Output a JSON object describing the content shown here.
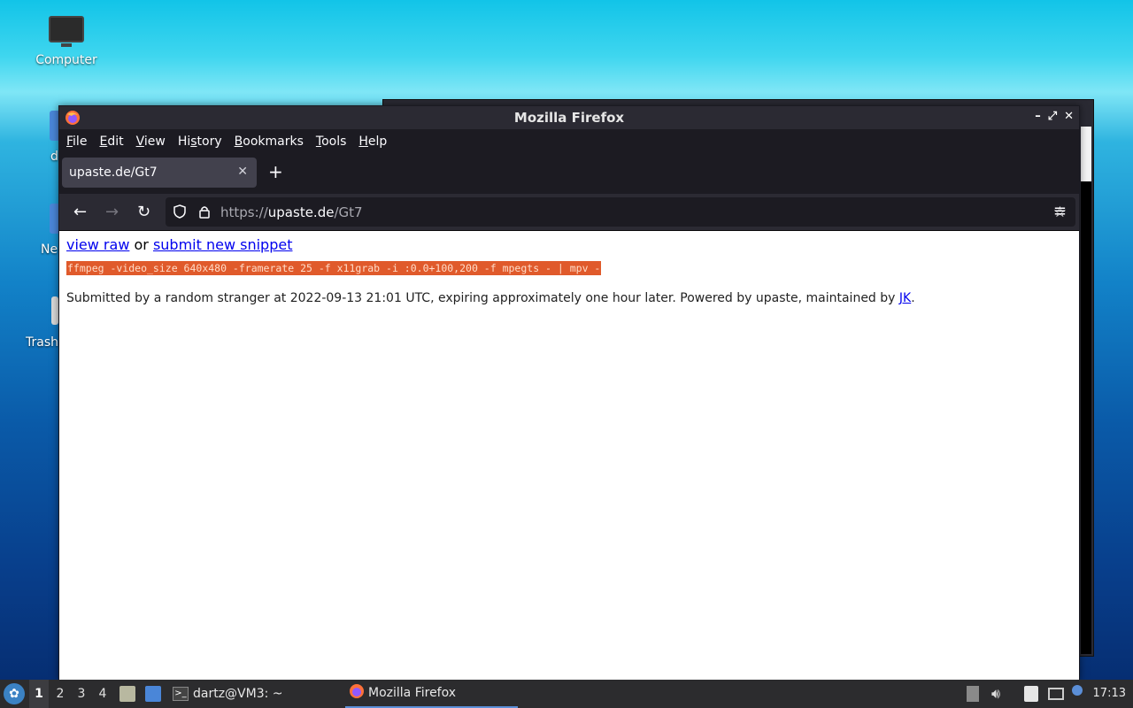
{
  "desktop": {
    "icons": [
      {
        "label": "Computer"
      },
      {
        "label": "d"
      },
      {
        "label": "Ne"
      },
      {
        "label": "Trash"
      }
    ]
  },
  "window": {
    "title": "Mozilla Firefox",
    "controls": {
      "minimize": "–",
      "maximize": "⤢",
      "close": "✕"
    }
  },
  "menubar": {
    "items": [
      {
        "label": "File",
        "mnemonic": "F",
        "rest": "ile"
      },
      {
        "label": "Edit",
        "mnemonic": "E",
        "rest": "dit"
      },
      {
        "label": "View",
        "mnemonic": "V",
        "rest": "iew"
      },
      {
        "label": "History",
        "mnemonic": "s",
        "pre": "Hi",
        "rest": "tory"
      },
      {
        "label": "Bookmarks",
        "mnemonic": "B",
        "rest": "ookmarks"
      },
      {
        "label": "Tools",
        "mnemonic": "T",
        "rest": "ools"
      },
      {
        "label": "Help",
        "mnemonic": "H",
        "rest": "elp"
      }
    ]
  },
  "tabs": [
    {
      "label": "upaste.de/Gt7",
      "close": "✕",
      "active": true
    }
  ],
  "newtab": "+",
  "navbar": {
    "back": "←",
    "forward": "→",
    "reload": "↻",
    "url_scheme": "https://",
    "url_host": "upaste.de",
    "url_path": "/Gt7",
    "bookmark_star": "☆",
    "menu": "≡"
  },
  "page": {
    "view_raw": "view raw",
    "or_text": " or ",
    "submit_new": "submit new snippet",
    "snippet": "ffmpeg -video_size 640x480 -framerate 25 -f x11grab -i :0.0+100,200 -f mpegts - | mpv -",
    "footer_text": "Submitted by a random stranger at 2022-09-13 21:01 UTC, expiring approximately one hour later. Powered by upaste, maintained by ",
    "footer_link": "JK",
    "footer_end": "."
  },
  "taskbar": {
    "workspaces": [
      "1",
      "2",
      "3",
      "4"
    ],
    "tasks": [
      {
        "label": "dartz@VM3: ~"
      },
      {
        "label": "Mozilla Firefox"
      }
    ],
    "clock": "17:13"
  },
  "colors": {
    "snippet_bg": "#e05a2b",
    "link": "#0000ee",
    "chrome_dark": "#1c1b22",
    "accent": "#5b8fd8"
  }
}
